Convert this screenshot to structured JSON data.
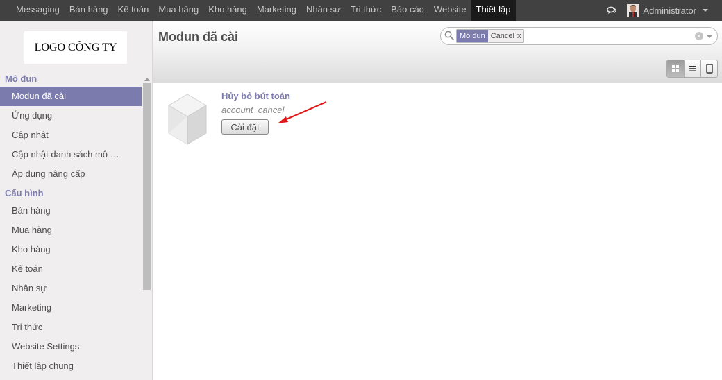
{
  "topbar": {
    "menu": [
      "Messaging",
      "Bán hàng",
      "Kế toán",
      "Mua hàng",
      "Kho hàng",
      "Marketing",
      "Nhân sự",
      "Tri thức",
      "Báo cáo",
      "Website",
      "Thiết lập"
    ],
    "active_index": 10,
    "user_name": "Administrator"
  },
  "sidebar": {
    "logo_text": "LOGO CÔNG TY",
    "sections": [
      {
        "title": "Mô đun",
        "items": [
          "Modun đã cài",
          "Ứng dụng",
          "Cập nhật",
          "Cập nhật danh sách mô …",
          "Áp dụng nâng cấp"
        ]
      },
      {
        "title": "Cấu hình",
        "items": [
          "Bán hàng",
          "Mua hàng",
          "Kho hàng",
          "Kế toán",
          "Nhân sự",
          "Marketing",
          "Tri thức",
          "Website Settings",
          "Thiết lập chung"
        ]
      }
    ],
    "active_item": "Modun đã cài"
  },
  "header": {
    "title": "Modun đã cài",
    "search": {
      "facet_category": "Mô đun",
      "facet_value": "Cancel",
      "facet_remove": "x"
    }
  },
  "module": {
    "name": "Hủy bỏ bút toán",
    "technical_name": "account_cancel",
    "install_label": "Cài đặt"
  },
  "colors": {
    "topbar": "#414141",
    "accent": "#7c7bad",
    "annotation_arrow": "#e0191b"
  }
}
